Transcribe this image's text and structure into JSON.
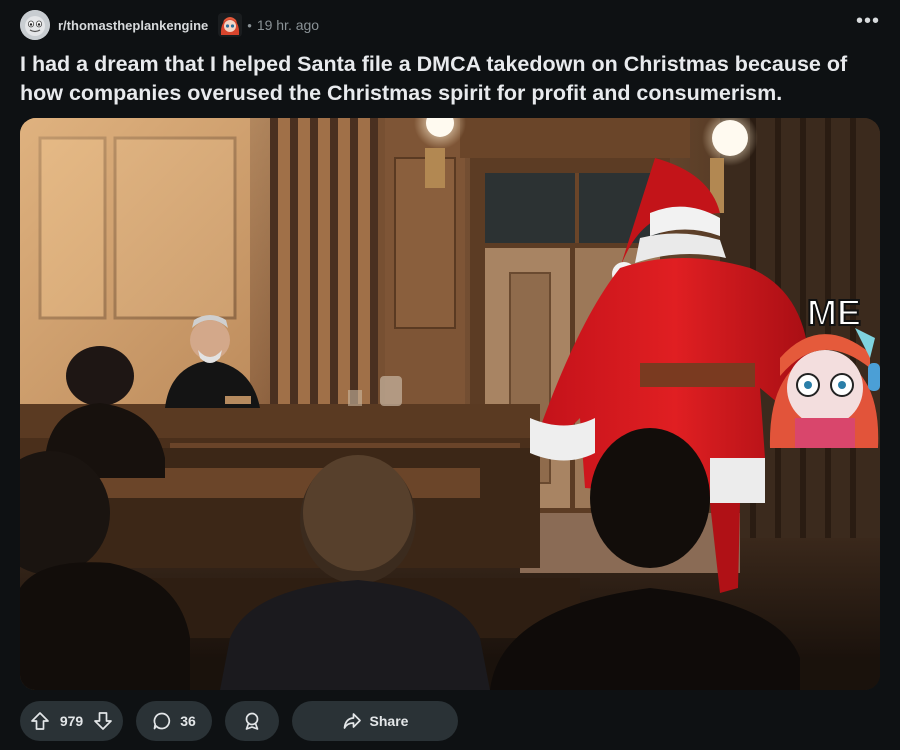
{
  "post": {
    "subreddit": "r/thomastheplankengine",
    "separator": "•",
    "time_ago": "19 hr. ago",
    "more_label": "•••",
    "title": "I had a dream that I helped Santa file a DMCA takedown on Christmas because of how companies overused the Christmas spirit for profit and consumerism.",
    "image": {
      "sticker_text": "ME"
    }
  },
  "actions": {
    "score": "979",
    "comments": "36",
    "share_label": "Share"
  },
  "icons": {
    "upvote": "arrow-up-icon",
    "downvote": "arrow-down-icon",
    "comment": "speech-bubble-icon",
    "award": "award-icon",
    "share": "share-arrow-icon",
    "more": "ellipsis-icon"
  },
  "colors": {
    "background": "#0e1113",
    "pill": "#2a3236",
    "text": "#d7dadc",
    "muted": "#8a9296"
  }
}
